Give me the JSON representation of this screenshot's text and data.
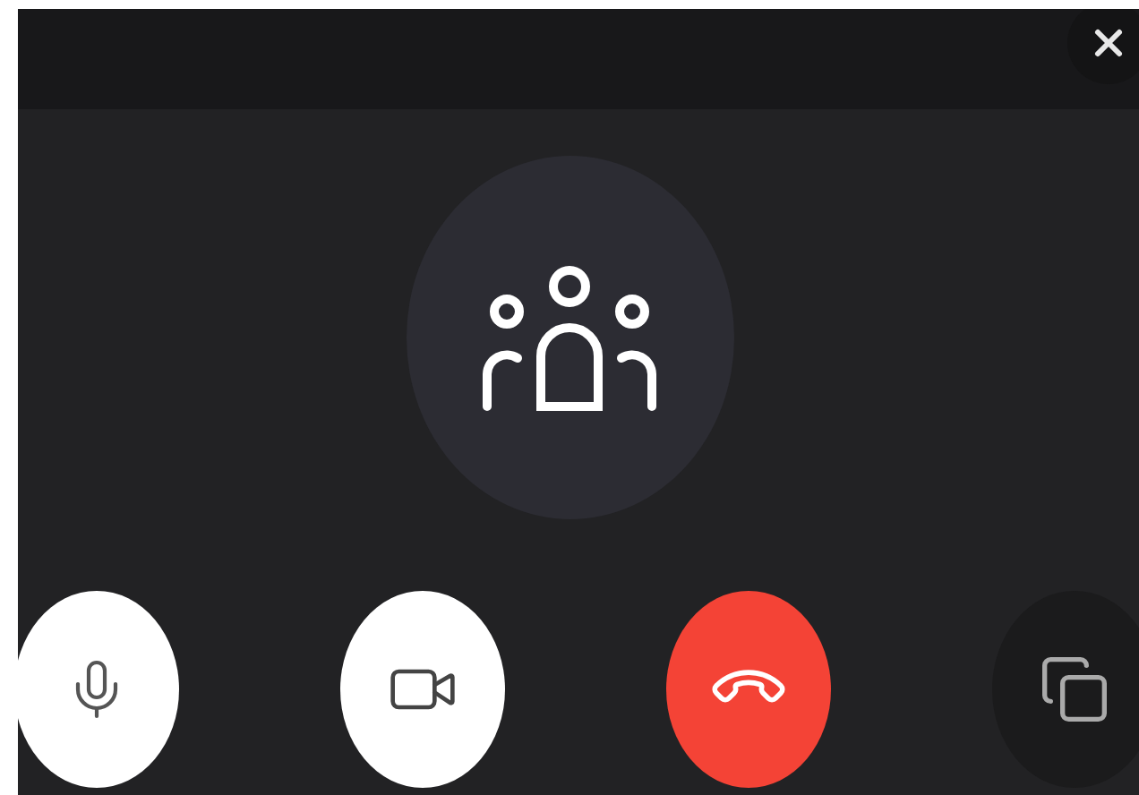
{
  "header": {
    "actions": [
      {
        "kind": "close"
      }
    ]
  },
  "call_avatar": {
    "kind": "group"
  },
  "controls": [
    {
      "kind": "microphone"
    },
    {
      "kind": "camera"
    },
    {
      "kind": "hang-up"
    },
    {
      "kind": "switch-window"
    }
  ]
}
